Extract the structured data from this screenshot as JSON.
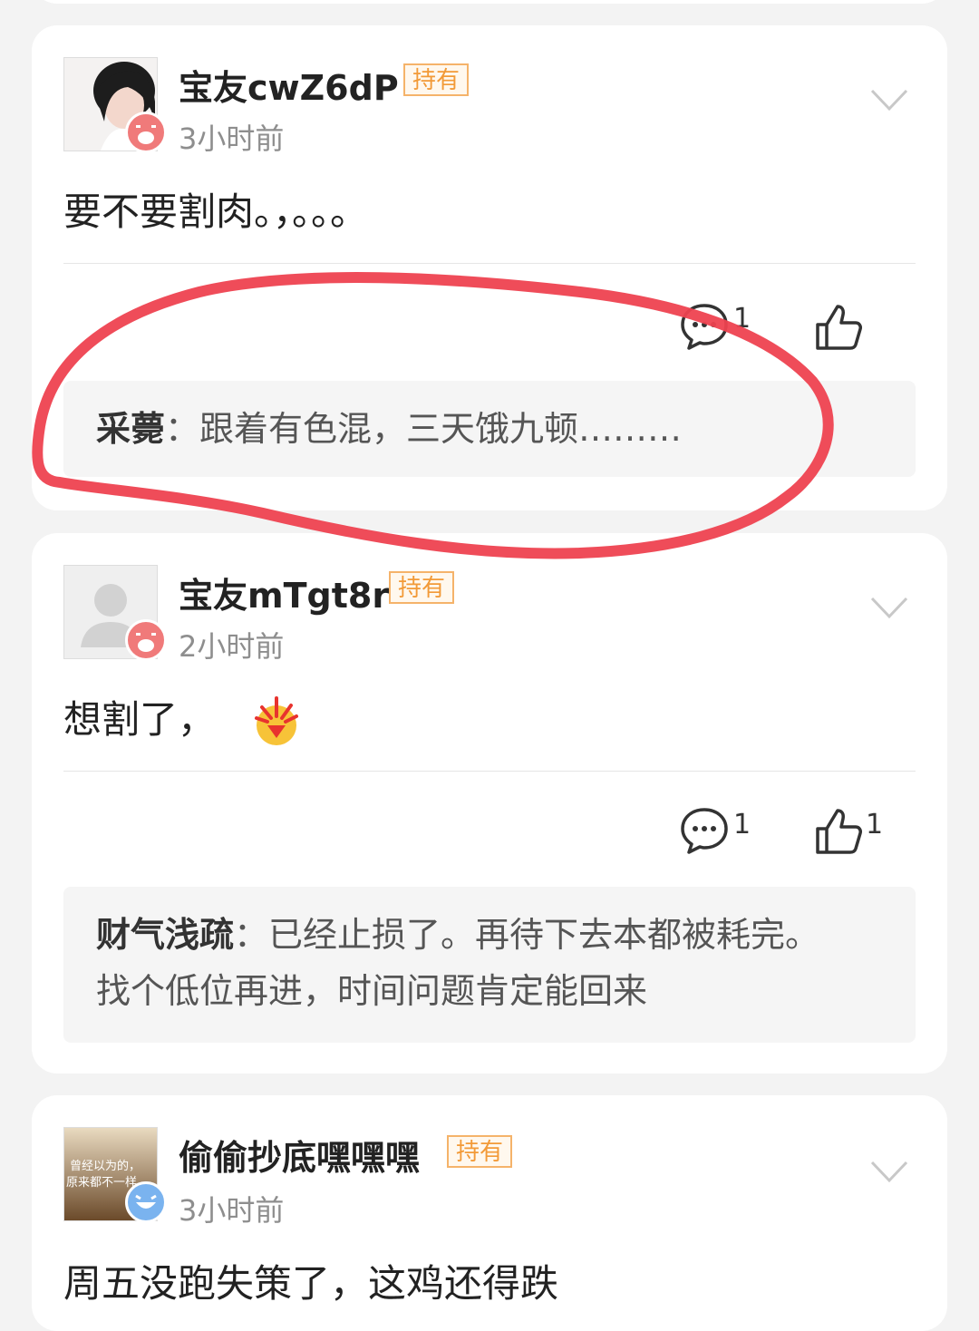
{
  "tag_label": "持有",
  "posts": [
    {
      "username": "宝友cwZ6dP",
      "time": "3小时前",
      "content": "要不要割肉。，。。。",
      "comment_count": "1",
      "like_count": "",
      "reply": {
        "name": "采薨",
        "sep": "：",
        "text": "跟着有色混，三天饿九顿………"
      }
    },
    {
      "username": "宝友mTgt8r",
      "time": "2小时前",
      "content": "想割了，",
      "comment_count": "1",
      "like_count": "1",
      "reply": {
        "name": "财气浅疏",
        "sep": "：",
        "text": "已经止损了。再待下去本都被耗完。",
        "text2": "找个低位再进，时间问题肯定能回来"
      }
    },
    {
      "username": "偷偷抄底嘿嘿嘿",
      "time": "3小时前",
      "content": "周五没跑失策了，这鸡还得跌",
      "avatar_text": [
        "曾经以为的，",
        "原来都不一样"
      ]
    }
  ],
  "colors": {
    "tag": "#f29a38",
    "annotation": "#ee4250",
    "cry_badge": "#f07a7a",
    "grin_badge": "#7ab3ef"
  },
  "icons": {
    "comment": "comment-bubble-icon",
    "like": "thumbs-up-icon",
    "expand": "chevron-down-icon"
  }
}
